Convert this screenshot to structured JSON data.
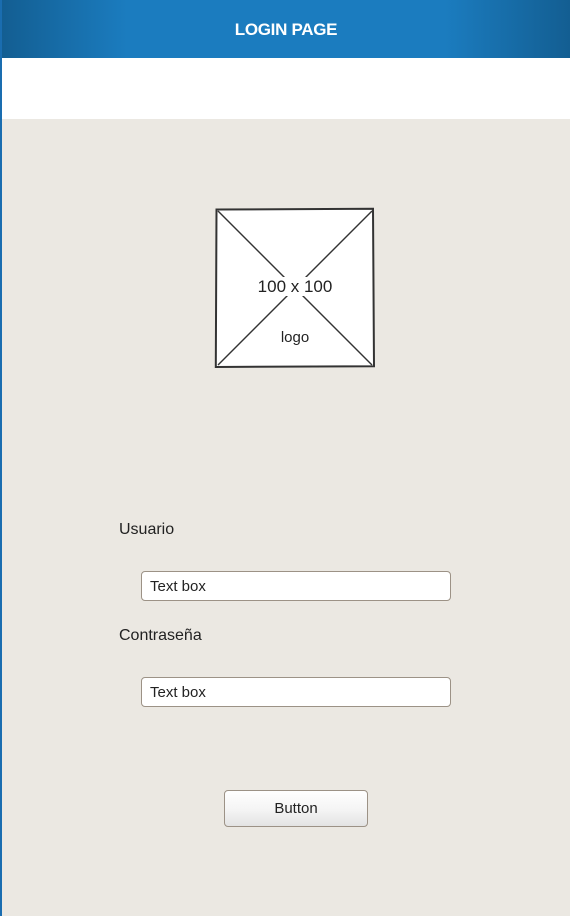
{
  "header": {
    "title": "LOGIN PAGE"
  },
  "logo": {
    "size_text": "100 x 100",
    "label": "logo",
    "icon": "image-placeholder-icon"
  },
  "form": {
    "username_label": "Usuario",
    "username_value": "Text box",
    "password_label": "Contraseña",
    "password_value": "Text box",
    "submit_label": "Button"
  },
  "colors": {
    "header_bg": "#1b7cbf",
    "content_bg": "#ebe8e2",
    "border_accent": "#1a6db0"
  }
}
